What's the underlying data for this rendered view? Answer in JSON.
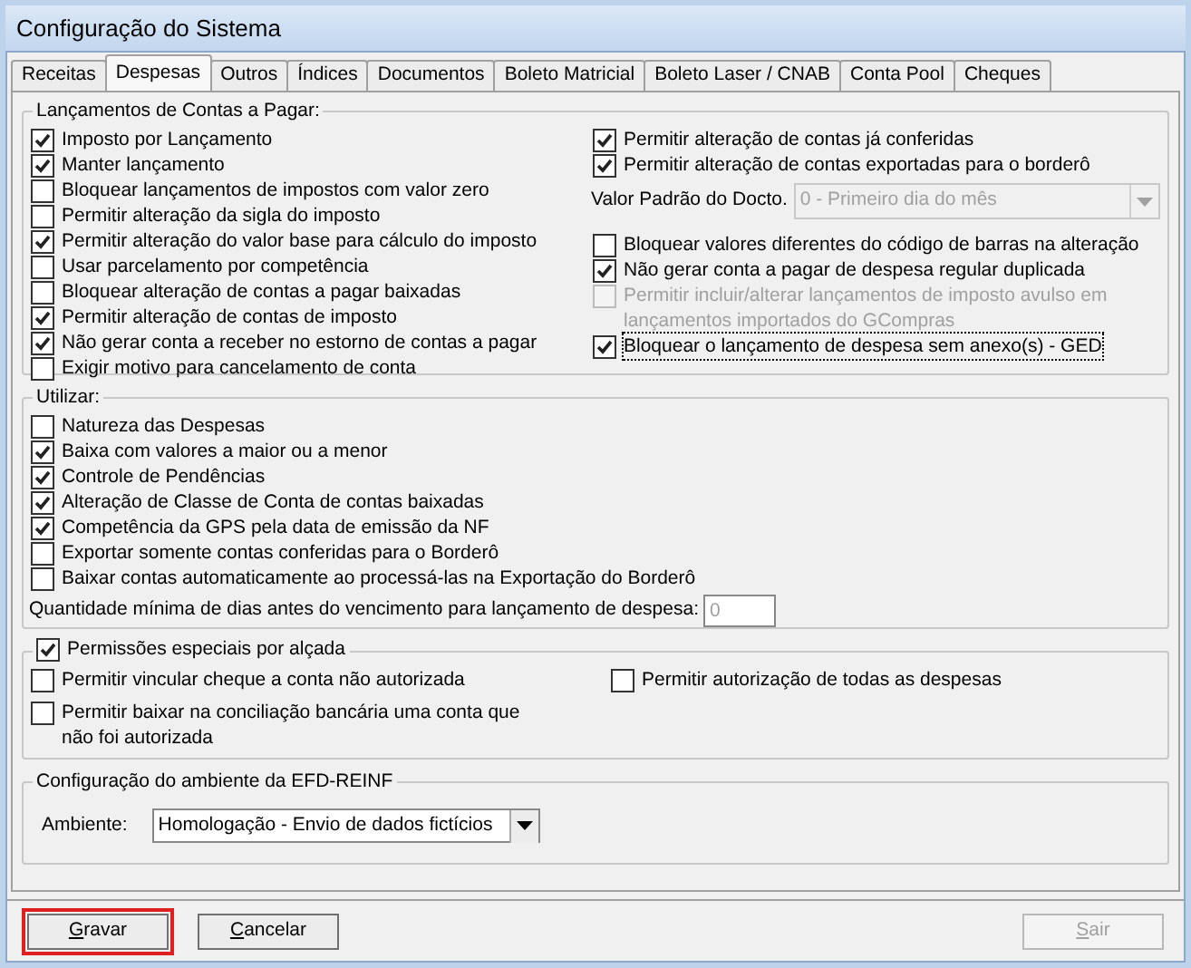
{
  "window": {
    "title": "Configuração do Sistema"
  },
  "tabs": [
    {
      "label": "Receitas",
      "selected": false
    },
    {
      "label": "Despesas",
      "selected": true
    },
    {
      "label": "Outros",
      "selected": false
    },
    {
      "label": "Índices",
      "selected": false
    },
    {
      "label": "Documentos",
      "selected": false
    },
    {
      "label": "Boleto Matricial",
      "selected": false
    },
    {
      "label": "Boleto Laser / CNAB",
      "selected": false
    },
    {
      "label": "Conta Pool",
      "selected": false
    },
    {
      "label": "Cheques",
      "selected": false
    }
  ],
  "contas_a_pagar": {
    "title": "Lançamentos de Contas a Pagar:",
    "left": [
      {
        "kind": "checkbox",
        "label": "Imposto por Lançamento",
        "checked": true,
        "disabled": false,
        "focused": false
      },
      {
        "kind": "checkbox",
        "label": "Manter lançamento",
        "checked": true,
        "disabled": false,
        "focused": false
      },
      {
        "kind": "checkbox",
        "label": "Bloquear lançamentos de impostos com valor zero",
        "checked": false,
        "disabled": false,
        "focused": false
      },
      {
        "kind": "checkbox",
        "label": "Permitir alteração da sigla do imposto",
        "checked": false,
        "disabled": false,
        "focused": false
      },
      {
        "kind": "checkbox",
        "label": "Permitir alteração do valor base para cálculo do imposto",
        "checked": true,
        "disabled": false,
        "focused": false
      },
      {
        "kind": "checkbox",
        "label": "Usar parcelamento por competência",
        "checked": false,
        "disabled": false,
        "focused": false
      },
      {
        "kind": "checkbox",
        "label": "Bloquear alteração de contas a pagar baixadas",
        "checked": false,
        "disabled": false,
        "focused": false
      },
      {
        "kind": "checkbox",
        "label": "Permitir alteração de contas de imposto",
        "checked": true,
        "disabled": false,
        "focused": false
      },
      {
        "kind": "checkbox",
        "label": "Não gerar conta a receber no estorno de contas a pagar",
        "checked": true,
        "disabled": false,
        "focused": false
      },
      {
        "kind": "checkbox",
        "label": "Exigir motivo para cancelamento de conta",
        "checked": false,
        "disabled": false,
        "focused": false
      }
    ],
    "right": [
      {
        "kind": "checkbox",
        "label": "Permitir alteração de contas já conferidas",
        "checked": true,
        "disabled": false,
        "focused": false
      },
      {
        "kind": "checkbox",
        "label": "Permitir alteração de contas exportadas para o borderô",
        "checked": true,
        "disabled": false,
        "focused": false
      },
      {
        "kind": "select",
        "label": "Valor Padrão do Docto.",
        "value": "0 - Primeiro dia do mês",
        "disabled": true
      },
      {
        "kind": "checkbox",
        "label": "Bloquear valores diferentes do código de barras na alteração",
        "checked": false,
        "disabled": false,
        "focused": false
      },
      {
        "kind": "checkbox",
        "label": "Não gerar conta a pagar de despesa regular duplicada",
        "checked": true,
        "disabled": false,
        "focused": false
      },
      {
        "kind": "checkbox",
        "label": "Permitir incluir/alterar lançamentos de imposto avulso em lançamentos importados do GCompras",
        "checked": false,
        "disabled": true,
        "focused": false
      },
      {
        "kind": "checkbox",
        "label": "Bloquear o lançamento de despesa sem anexo(s) - GED",
        "checked": true,
        "disabled": false,
        "focused": true
      }
    ]
  },
  "utilizar": {
    "title": "Utilizar:",
    "items": [
      {
        "label": "Natureza das Despesas",
        "checked": false
      },
      {
        "label": "Baixa com valores a maior ou a menor",
        "checked": true
      },
      {
        "label": "Controle de Pendências",
        "checked": true
      },
      {
        "label": "Alteração de Classe de Conta de contas baixadas",
        "checked": true
      },
      {
        "label": "Competência da GPS pela data de emissão da NF",
        "checked": true
      },
      {
        "label": "Exportar somente contas conferidas para o Borderô",
        "checked": false
      },
      {
        "label": "Baixar contas automaticamente ao processá-las na Exportação do Borderô",
        "checked": false
      }
    ],
    "min_days": {
      "label": "Quantidade mínima de dias antes do vencimento para lançamento de despesa:",
      "value": "0",
      "disabled": true
    }
  },
  "permissoes": {
    "title": "Permissões especiais por alçada",
    "checked": true,
    "left": [
      {
        "label": "Permitir vincular cheque a conta não autorizada",
        "checked": false
      },
      {
        "label": "Permitir baixar na conciliação bancária uma conta que não foi autorizada",
        "checked": false
      }
    ],
    "right": [
      {
        "label": "Permitir autorização de todas as despesas",
        "checked": false
      }
    ]
  },
  "efd_reinf": {
    "title": "Configuração do ambiente da EFD-REINF",
    "label": "Ambiente:",
    "value": "Homologação - Envio de dados fictícios"
  },
  "buttons": [
    {
      "label": "Gravar",
      "disabled": false,
      "highlighted": true
    },
    {
      "label": "Cancelar",
      "disabled": false,
      "highlighted": false
    },
    {
      "label": "Sair",
      "disabled": true,
      "highlighted": false
    }
  ]
}
